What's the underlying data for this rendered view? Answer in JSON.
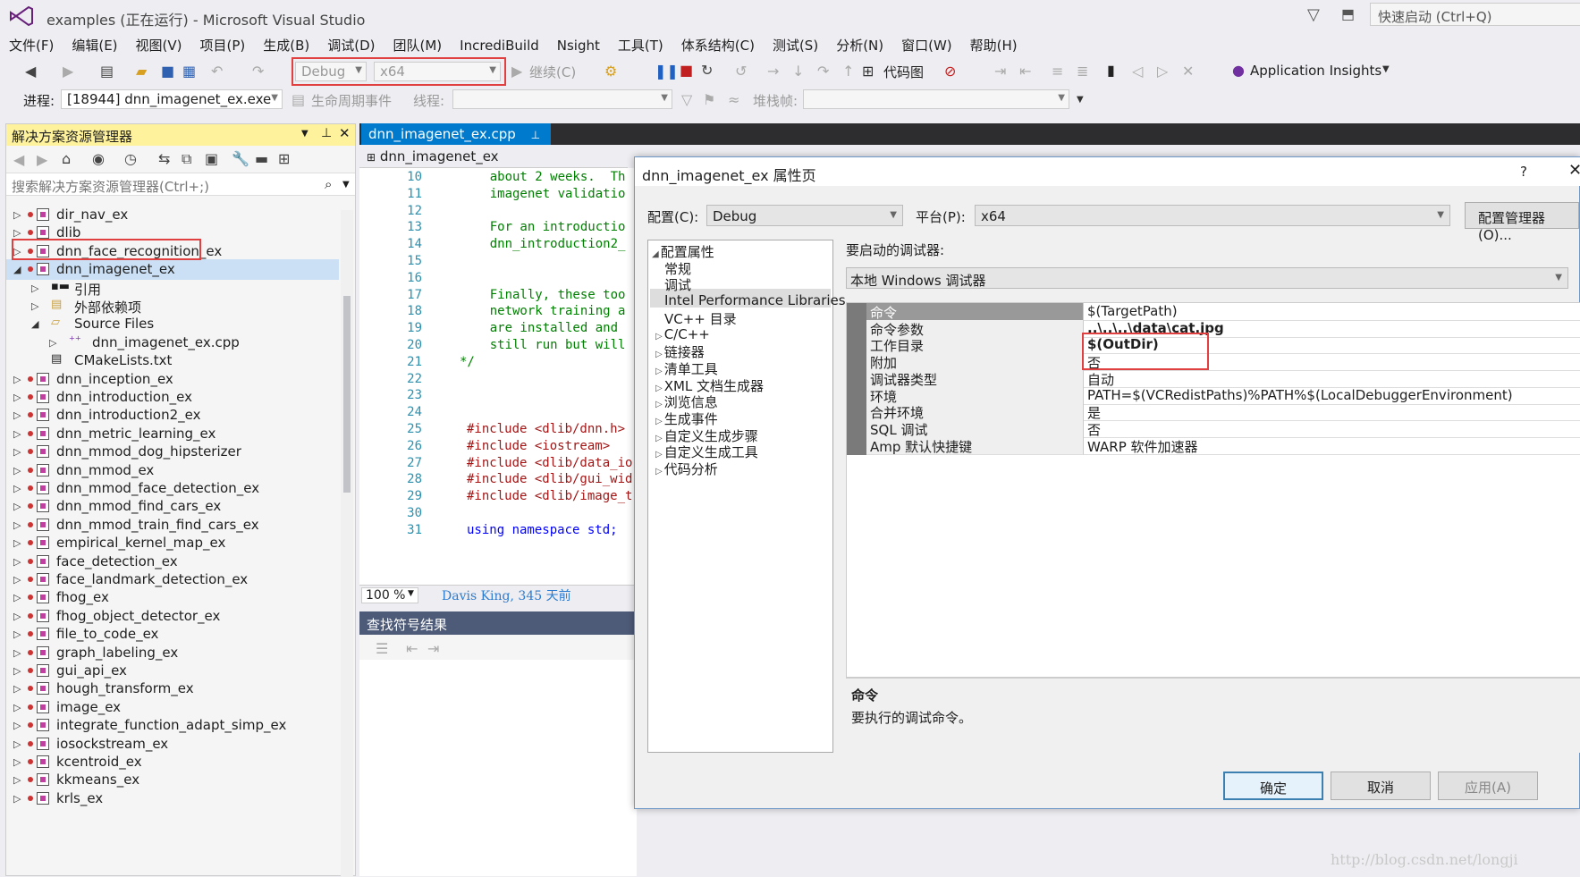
{
  "window": {
    "title": "examples (正在运行) - Microsoft Visual Studio",
    "quick_launch": "快速启动 (Ctrl+Q)"
  },
  "menu": [
    "文件(F)",
    "编辑(E)",
    "视图(V)",
    "项目(P)",
    "生成(B)",
    "调试(D)",
    "团队(M)",
    "IncrediBuild",
    "Nsight",
    "工具(T)",
    "体系结构(C)",
    "测试(S)",
    "分析(N)",
    "窗口(W)",
    "帮助(H)"
  ],
  "toolbar1": {
    "config": "Debug",
    "platform": "x64",
    "continue": "继续(C)",
    "codemap": "代码图",
    "app_insights": "Application Insights"
  },
  "toolbar2": {
    "process_label": "进程:",
    "process": "[18944] dnn_imagenet_ex.exe",
    "lifecycle": "生命周期事件",
    "thread_label": "线程:",
    "stack_label": "堆栈帧:"
  },
  "solution": {
    "title": "解决方案资源管理器",
    "search_placeholder": "搜索解决方案资源管理器(Ctrl+;)",
    "items": [
      "dir_nav_ex",
      "dlib",
      "dnn_face_recognition_ex",
      "dnn_imagenet_ex",
      "引用",
      "外部依赖项",
      "Source Files",
      "dnn_imagenet_ex.cpp",
      "CMakeLists.txt",
      "dnn_inception_ex",
      "dnn_introduction_ex",
      "dnn_introduction2_ex",
      "dnn_metric_learning_ex",
      "dnn_mmod_dog_hipsterizer",
      "dnn_mmod_ex",
      "dnn_mmod_face_detection_ex",
      "dnn_mmod_find_cars_ex",
      "dnn_mmod_train_find_cars_ex",
      "empirical_kernel_map_ex",
      "face_detection_ex",
      "face_landmark_detection_ex",
      "fhog_ex",
      "fhog_object_detector_ex",
      "file_to_code_ex",
      "graph_labeling_ex",
      "gui_api_ex",
      "hough_transform_ex",
      "image_ex",
      "integrate_function_adapt_simp_ex",
      "iosockstream_ex",
      "kcentroid_ex",
      "kkmeans_ex",
      "krls_ex"
    ]
  },
  "editor": {
    "tab": "dnn_imagenet_ex.cpp",
    "nav": "dnn_imagenet_ex",
    "zoom": "100 %",
    "blame": "Davis King, 345 天前",
    "lines": [
      {
        "n": "10",
        "t": "    about 2 weeks.  Th",
        "c": "cmt"
      },
      {
        "n": "11",
        "t": "    imagenet validatio",
        "c": "cmt"
      },
      {
        "n": "12",
        "t": "",
        "c": "cmt"
      },
      {
        "n": "13",
        "t": "    For an introductio",
        "c": "cmt"
      },
      {
        "n": "14",
        "t": "    dnn_introduction2_",
        "c": "cmt"
      },
      {
        "n": "15",
        "t": "",
        "c": "cmt"
      },
      {
        "n": "16",
        "t": "",
        "c": "cmt"
      },
      {
        "n": "17",
        "t": "    Finally, these too",
        "c": "cmt"
      },
      {
        "n": "18",
        "t": "    network training a",
        "c": "cmt"
      },
      {
        "n": "19",
        "t": "    are installed and ",
        "c": "cmt"
      },
      {
        "n": "20",
        "t": "    still run but will",
        "c": "cmt"
      },
      {
        "n": "21",
        "t": "*/",
        "c": "cmt"
      },
      {
        "n": "22",
        "t": "",
        "c": ""
      },
      {
        "n": "23",
        "t": "",
        "c": ""
      },
      {
        "n": "24",
        "t": "",
        "c": ""
      },
      {
        "n": "25",
        "t": "#include <dlib/dnn.h>",
        "c": "inc"
      },
      {
        "n": "26",
        "t": "#include <iostream>",
        "c": "inc"
      },
      {
        "n": "27",
        "t": "#include <dlib/data_io",
        "c": "inc"
      },
      {
        "n": "28",
        "t": "#include <dlib/gui_wid",
        "c": "inc"
      },
      {
        "n": "29",
        "t": "#include <dlib/image_t",
        "c": "inc"
      },
      {
        "n": "30",
        "t": "",
        "c": ""
      },
      {
        "n": "31",
        "t": "using namespace std;",
        "c": "kw"
      }
    ]
  },
  "find": {
    "title": "查找符号结果"
  },
  "dialog": {
    "title": "dnn_imagenet_ex 属性页",
    "help": "?",
    "config_label": "配置(C):",
    "config": "Debug",
    "platform_label": "平台(P):",
    "platform": "x64",
    "config_manager": "配置管理器(O)...",
    "tree": [
      "配置属性",
      "常规",
      "调试",
      "Intel Performance Libraries",
      "VC++ 目录",
      "C/C++",
      "链接器",
      "清单工具",
      "XML 文档生成器",
      "浏览信息",
      "生成事件",
      "自定义生成步骤",
      "自定义生成工具",
      "代码分析"
    ],
    "debugger_label": "要启动的调试器:",
    "debugger": "本地 Windows 调试器",
    "props": [
      {
        "k": "命令",
        "v": "$(TargetPath)"
      },
      {
        "k": "命令参数",
        "v": "..\\..\\..\\data\\cat.jpg"
      },
      {
        "k": "工作目录",
        "v": "$(OutDir)"
      },
      {
        "k": "附加",
        "v": "否"
      },
      {
        "k": "调试器类型",
        "v": "自动"
      },
      {
        "k": "环境",
        "v": "PATH=$(VCRedistPaths)%PATH%$(LocalDebuggerEnvironment)"
      },
      {
        "k": "合并环境",
        "v": "是"
      },
      {
        "k": "SQL 调试",
        "v": "否"
      },
      {
        "k": "Amp 默认快捷键",
        "v": "WARP 软件加速器"
      }
    ],
    "desc_title": "命令",
    "desc_text": "要执行的调试命令。",
    "ok": "确定",
    "cancel": "取消",
    "apply": "应用(A)"
  },
  "watermark": "http://blog.csdn.net/longji",
  "colors": {
    "accent": "#007acc",
    "highlight_box": "#e04040",
    "selected_header": "#fef29c"
  }
}
